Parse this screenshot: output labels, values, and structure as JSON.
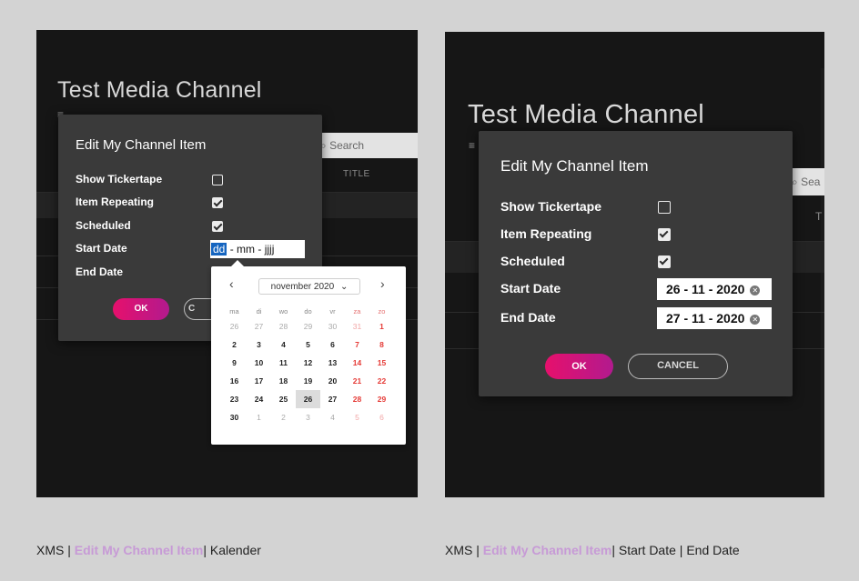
{
  "left": {
    "app_title": "Test Media Channel",
    "search_placeholder": "Search",
    "column_title": "TITLE",
    "dialog": {
      "title": "Edit My Channel Item",
      "fields": [
        {
          "label": "Show Tickertape",
          "checked": false
        },
        {
          "label": "Item Repeating",
          "checked": true
        },
        {
          "label": "Scheduled",
          "checked": true
        }
      ],
      "start_date_label": "Start Date",
      "end_date_label": "End Date",
      "start_date_segments": [
        "dd",
        "mm",
        "jjjj"
      ],
      "ok_label": "OK",
      "cancel_partial": "C"
    },
    "calendar": {
      "month_label": "november 2020",
      "weekdays": [
        "ma",
        "di",
        "wo",
        "do",
        "vr",
        "za",
        "zo"
      ],
      "weeks": [
        [
          "26",
          "27",
          "28",
          "29",
          "30",
          "31",
          "1"
        ],
        [
          "2",
          "3",
          "4",
          "5",
          "6",
          "7",
          "8"
        ],
        [
          "9",
          "10",
          "11",
          "12",
          "13",
          "14",
          "15"
        ],
        [
          "16",
          "17",
          "18",
          "19",
          "20",
          "21",
          "22"
        ],
        [
          "23",
          "24",
          "25",
          "26",
          "27",
          "28",
          "29"
        ],
        [
          "30",
          "1",
          "2",
          "3",
          "4",
          "5",
          "6"
        ]
      ],
      "selected_day": "26"
    }
  },
  "right": {
    "app_title": "Test Media Channel",
    "search_partial": "Sea",
    "column_partial": "T",
    "dialog": {
      "title": "Edit My Channel Item",
      "fields": [
        {
          "label": "Show Tickertape",
          "checked": false
        },
        {
          "label": "Item Repeating",
          "checked": true
        },
        {
          "label": "Scheduled",
          "checked": true
        }
      ],
      "start_date_label": "Start Date",
      "end_date_label": "End Date",
      "start_date_value": "26 - 11 - 2020",
      "end_date_value": "27 - 11 - 2020",
      "ok_label": "OK",
      "cancel_label": "CANCEL"
    }
  },
  "captions": {
    "left": {
      "prefix": "XMS | ",
      "highlight": "Edit My Channel Item",
      "suffix": "| Kalender"
    },
    "right": {
      "prefix": "XMS | ",
      "highlight": "Edit My Channel Item",
      "suffix": "| Start Date | End Date"
    }
  },
  "colors": {
    "accent_pink": "#e6106c",
    "accent_purple": "#b21a8e",
    "caption_highlight": "#c79ad6",
    "selection_blue": "#1565c0",
    "weekend_red": "#e53935"
  },
  "icons": [
    "list-icon",
    "search-icon",
    "chevron-left-icon",
    "chevron-right-icon",
    "chevron-down-icon",
    "clear-icon"
  ]
}
